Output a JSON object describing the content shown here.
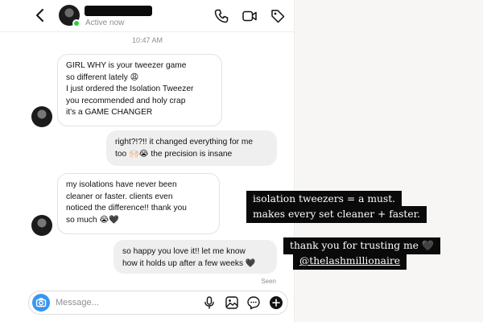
{
  "header": {
    "status": "Active now",
    "icons": [
      "chevron-left-icon",
      "phone-icon",
      "video-icon",
      "tag-icon"
    ]
  },
  "timestamp": "10:47 AM",
  "messages": [
    {
      "from": "them",
      "text": "GIRL WHY is your tweezer game\nso different lately 😩\nI just ordered the Isolation Tweezer\nyou recommended and holy crap\nit's a GAME CHANGER"
    },
    {
      "from": "me",
      "text": "right?!?!! it changed everything for me\ntoo 🙌🏻😭 the precision is insane"
    },
    {
      "from": "them",
      "text": "my isolations have never been\ncleaner or faster. clients even\nnoticed the difference!! thank you\nso much 😭🖤"
    },
    {
      "from": "me",
      "text": "so happy you love it!! let me know\nhow it holds up after a few weeks 🖤"
    }
  ],
  "seen": "Seen",
  "composer": {
    "placeholder": "Message...",
    "icons": [
      "camera-icon",
      "microphone-icon",
      "gallery-icon",
      "sticker-icon",
      "add-icon"
    ]
  },
  "captions": {
    "line1": "isolation tweezers = a must.",
    "line2": "makes every set cleaner + faster.",
    "line3": "thank you for trusting me 🖤",
    "handle": "@thelashmillionaire"
  },
  "colors": {
    "accent": "#3797f0",
    "online": "#2ecc40",
    "caption_bg": "#0a0a0a"
  }
}
